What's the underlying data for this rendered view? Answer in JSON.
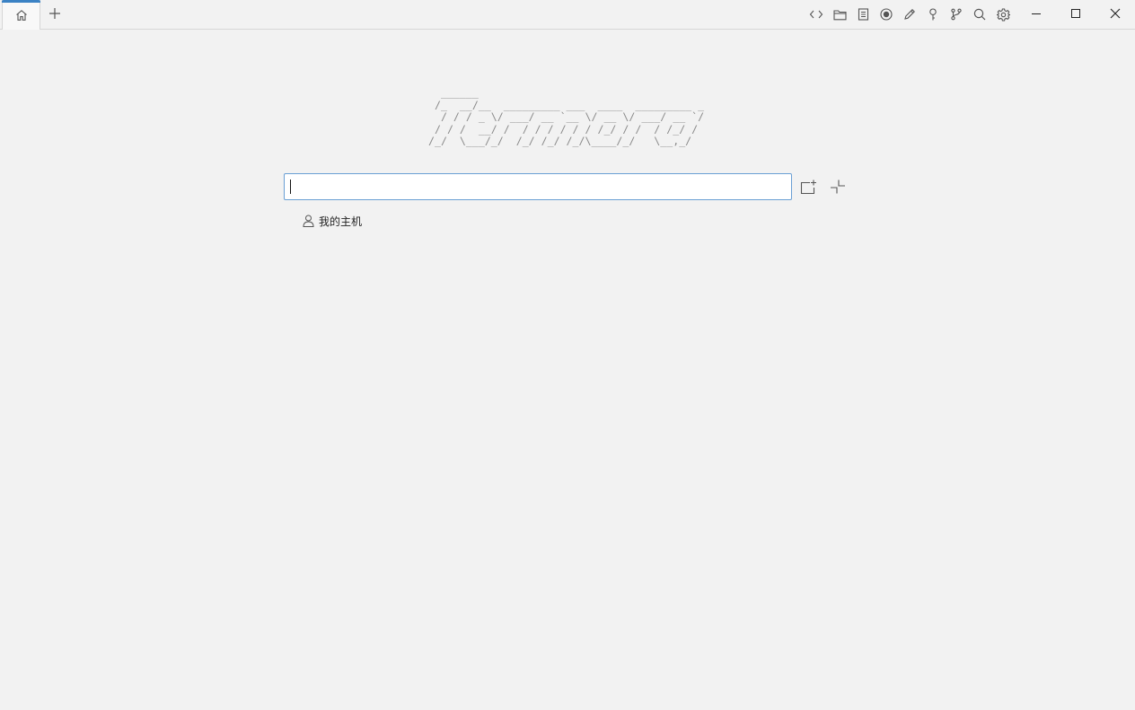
{
  "tabs": [
    {
      "icon": "home-icon",
      "active": true
    }
  ],
  "toolbar": {
    "icons": [
      "code-icon",
      "folder-icon",
      "document-icon",
      "record-icon",
      "pencil-icon",
      "key-icon",
      "branch-icon",
      "search-icon",
      "gear-icon"
    ]
  },
  "window_controls": [
    "minimize-icon",
    "maximize-icon",
    "close-icon"
  ],
  "banner": {
    "ascii_art": "  ______\n /_  __/__  _________ ___  ____  _________ _\n  / / / _ \\/ ___/ __ `__ \\/ __ \\/ ___/ __ `/\n / / /  __/ /  / / / / / / /_/ / /  / /_/ /\n/_/  \\___/_/  /_/ /_/ /_/\\____/_/   \\__,_/"
  },
  "search": {
    "value": "",
    "placeholder": ""
  },
  "host_list": [
    {
      "label": "我的主机",
      "icon": "user-icon"
    }
  ],
  "colors": {
    "background": "#f2f2f2",
    "accent": "#3b82c4",
    "input_border": "#6a9fd4",
    "icon": "#555555"
  }
}
